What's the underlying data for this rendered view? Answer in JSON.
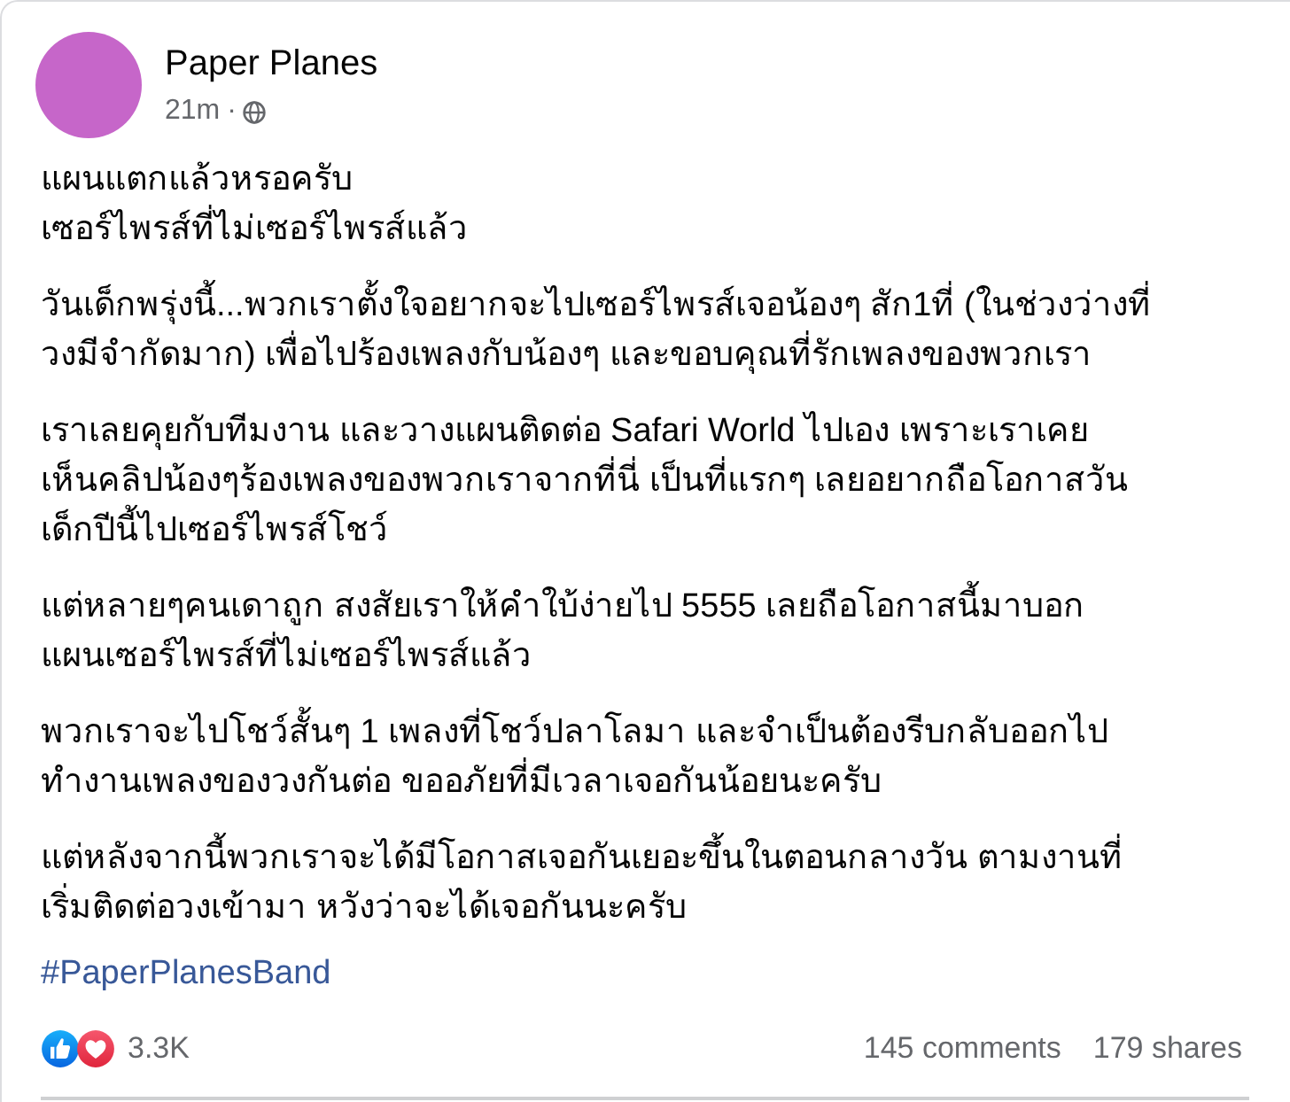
{
  "post": {
    "author": {
      "name": "Paper Planes"
    },
    "time": "21m",
    "separator": "·",
    "paragraphs": [
      "แผนแตกแล้วหรอครับ\nเซอร์ไพรส์ที่ไม่เซอร์ไพรส์แล้ว",
      "วันเด็กพรุ่งนี้...พวกเราตั้งใจอยากจะไปเซอร์ไพรส์เจอน้องๆ สัก1ที่ (ในช่วงว่างที่\nวงมีจำกัดมาก) เพื่อไปร้องเพลงกับน้องๆ และขอบคุณที่รักเพลงของพวกเรา",
      "เราเลยคุยกับทีมงาน และวางแผนติดต่อ Safari World ไปเอง เพราะเราเคย\nเห็นคลิปน้องๆร้องเพลงของพวกเราจากที่นี่ เป็นที่แรกๆ เลยอยากถือโอกาสวัน\nเด็กปีนี้ไปเซอร์ไพรส์โชว์",
      "แต่หลายๆคนเดาถูก สงสัยเราให้คำใบ้ง่ายไป 5555 เลยถือโอกาสนี้มาบอก\nแผนเซอร์ไพรส์ที่ไม่เซอร์ไพรส์แล้ว",
      "พวกเราจะไปโชว์สั้นๆ 1 เพลงที่โชว์ปลาโลมา และจำเป็นต้องรีบกลับออกไป\nทำงานเพลงของวงกันต่อ ขออภัยที่มีเวลาเจอกันน้อยนะครับ",
      "แต่หลังจากนี้พวกเราจะได้มีโอกาสเจอกันเยอะขึ้นในตอนกลางวัน ตามงานที่\nเริ่มติดต่อวงเข้ามา หวังว่าจะได้เจอกันนะครับ"
    ],
    "hashtag": "#PaperPlanesBand",
    "reactions": {
      "count": "3.3K"
    },
    "comments": "145 comments",
    "shares": "179 shares"
  }
}
